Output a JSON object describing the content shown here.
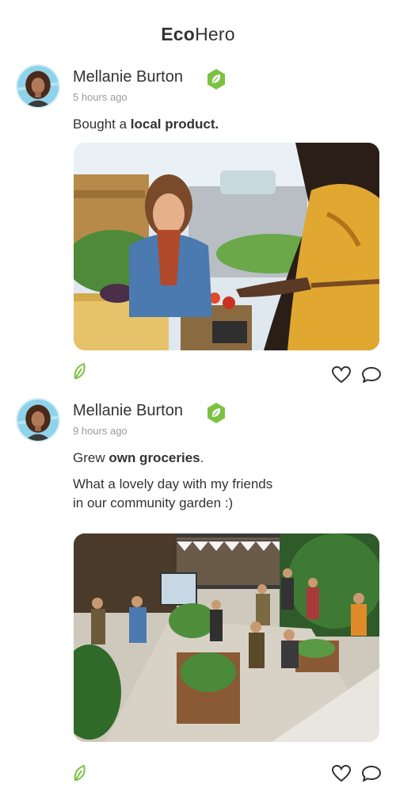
{
  "app": {
    "title_bold": "Eco",
    "title_light": "Hero"
  },
  "posts": [
    {
      "user": "Mellanie Burton",
      "time": "5 hours ago",
      "action_prefix": "Bought a ",
      "action_bold": "local product.",
      "action_suffix": "",
      "body_line1": "",
      "body_line2": ""
    },
    {
      "user": "Mellanie Burton",
      "time": "9 hours ago",
      "action_prefix": "Grew ",
      "action_bold": "own groceries",
      "action_suffix": ".",
      "body_line1": "What a lovely day with my friends",
      "body_line2": "in our community garden :)"
    }
  ],
  "colors": {
    "accent": "#7cc242",
    "text": "#333333",
    "muted": "#9a9a9a"
  },
  "icons": {
    "badge": "leaf-badge-icon",
    "leaf": "leaf-icon",
    "like": "heart-icon",
    "comment": "comment-icon"
  }
}
